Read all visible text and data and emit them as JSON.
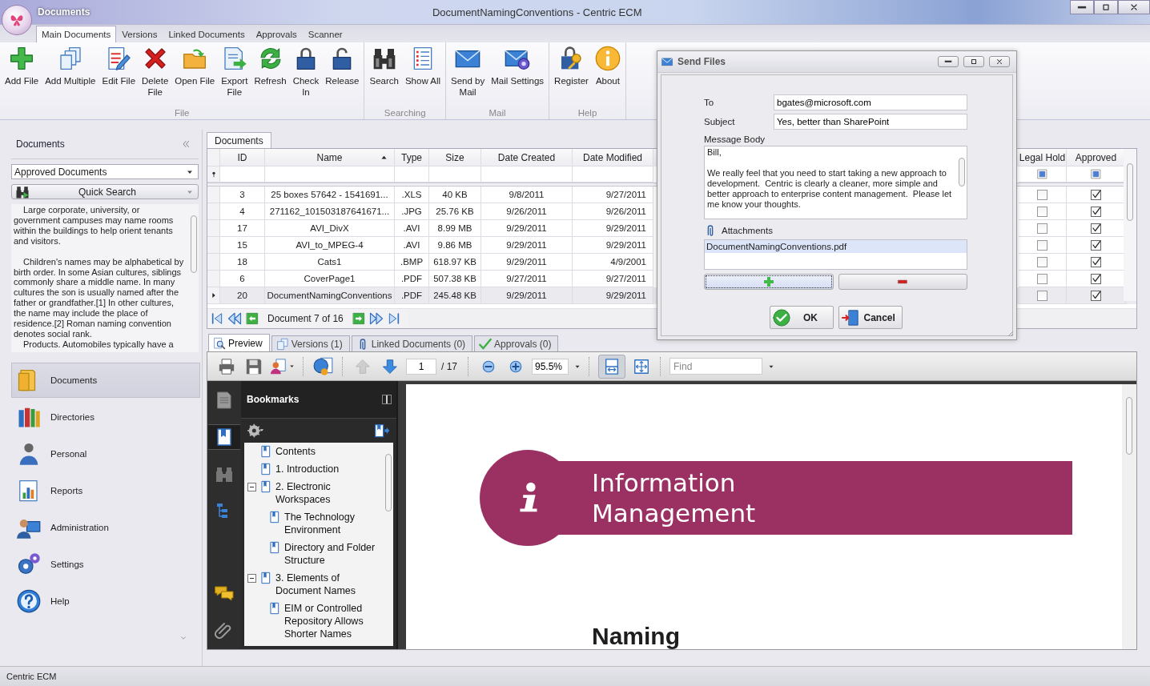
{
  "title_bar": {
    "menu_label": "Documents",
    "title": "DocumentNamingConventions - Centric ECM"
  },
  "ribbon_tabs": [
    {
      "label": "Main Documents",
      "selected": true
    },
    {
      "label": "Versions",
      "selected": false
    },
    {
      "label": "Linked Documents",
      "selected": false
    },
    {
      "label": "Approvals",
      "selected": false
    },
    {
      "label": "Scanner",
      "selected": false
    }
  ],
  "ribbon_groups": [
    {
      "label": "File",
      "buttons": [
        {
          "label": "Add File",
          "kind": "add"
        },
        {
          "label": "Add Multiple",
          "kind": "multiple"
        },
        {
          "label": "Edit File",
          "kind": "edit"
        },
        {
          "label": "Delete\nFile",
          "kind": "delete"
        },
        {
          "label": "Open File",
          "kind": "open"
        },
        {
          "label": "Export\nFile",
          "kind": "export"
        },
        {
          "label": "Refresh",
          "kind": "refresh"
        },
        {
          "label": "Check\nIn",
          "kind": "checkin"
        },
        {
          "label": "Release",
          "kind": "release"
        }
      ]
    },
    {
      "label": "Searching",
      "buttons": [
        {
          "label": "Search",
          "kind": "search"
        },
        {
          "label": "Show All",
          "kind": "list"
        }
      ]
    },
    {
      "label": "Mail",
      "buttons": [
        {
          "label": "Send by\nMail",
          "kind": "mail"
        },
        {
          "label": "Mail Settings",
          "kind": "mailsettings"
        }
      ]
    },
    {
      "label": "Help",
      "buttons": [
        {
          "label": "Register",
          "kind": "register"
        },
        {
          "label": "About",
          "kind": "about"
        }
      ]
    }
  ],
  "sidebar": {
    "title": "Documents",
    "filter": "Approved Documents",
    "quick_search": "Quick Search",
    "description": [
      "Large corporate, university, or government campuses may name rooms within the buildings to help orient tenants and visitors.",
      "Children's names may be alphabetical by birth order. In some Asian cultures, siblings commonly share a middle name. In many cultures the son is usually named after the father or grandfather.[1] In other cultures, the name may include the place of residence.[2] Roman naming convention denotes social rank.",
      "Products. Automobiles typically have a"
    ],
    "items": [
      {
        "label": "Documents",
        "kind": "documents",
        "selected": true
      },
      {
        "label": "Directories",
        "kind": "directories",
        "selected": false
      },
      {
        "label": "Personal",
        "kind": "personal",
        "selected": false
      },
      {
        "label": "Reports",
        "kind": "reports",
        "selected": false
      },
      {
        "label": "Administration",
        "kind": "administration",
        "selected": false
      },
      {
        "label": "Settings",
        "kind": "settings",
        "selected": false
      },
      {
        "label": "Help",
        "kind": "help",
        "selected": false
      }
    ]
  },
  "documents_tab": "Documents",
  "table": {
    "columns": [
      {
        "label": "ID",
        "sorted": false
      },
      {
        "label": "Name",
        "sorted": true
      },
      {
        "label": "Type",
        "sorted": false
      },
      {
        "label": "Size",
        "sorted": false
      },
      {
        "label": "Date Created",
        "sorted": false
      },
      {
        "label": "Date Modified",
        "sorted": false
      },
      {
        "label": "Legal Hold",
        "sorted": false
      },
      {
        "label": "Approved",
        "sorted": false
      }
    ],
    "rows": [
      {
        "id": "3",
        "name": "25 boxes 57642 - 1541691...",
        "type": ".XLS",
        "size": "40 KB",
        "created": "9/8/2011",
        "modified": "9/27/2011",
        "legal_hold": false,
        "approved": true,
        "selected": false
      },
      {
        "id": "4",
        "name": "271162_101503187641671...",
        "type": ".JPG",
        "size": "25.76 KB",
        "created": "9/26/2011",
        "modified": "9/26/2011",
        "legal_hold": false,
        "approved": true,
        "selected": false
      },
      {
        "id": "17",
        "name": "AVI_DivX",
        "type": ".AVI",
        "size": "8.99 MB",
        "created": "9/29/2011",
        "modified": "9/29/2011",
        "legal_hold": false,
        "approved": true,
        "selected": false
      },
      {
        "id": "15",
        "name": "AVI_to_MPEG-4",
        "type": ".AVI",
        "size": "9.86 MB",
        "created": "9/29/2011",
        "modified": "9/29/2011",
        "legal_hold": false,
        "approved": true,
        "selected": false
      },
      {
        "id": "18",
        "name": "Cats1",
        "type": ".BMP",
        "size": "618.97 KB",
        "created": "9/29/2011",
        "modified": "4/9/2001",
        "legal_hold": false,
        "approved": true,
        "selected": false
      },
      {
        "id": "6",
        "name": "CoverPage1",
        "type": ".PDF",
        "size": "507.38 KB",
        "created": "9/27/2011",
        "modified": "9/27/2011",
        "legal_hold": false,
        "approved": true,
        "selected": false
      },
      {
        "id": "20",
        "name": "DocumentNamingConventions",
        "type": ".PDF",
        "size": "245.48 KB",
        "created": "9/29/2011",
        "modified": "9/29/2011",
        "legal_hold": false,
        "approved": true,
        "selected": true
      }
    ]
  },
  "navigator": "Document 7 of 16",
  "preview_tabs": [
    {
      "label": "Preview",
      "kind": "preview",
      "selected": true
    },
    {
      "label": "Versions (1)",
      "kind": "versions",
      "selected": false
    },
    {
      "label": "Linked Documents (0)",
      "kind": "linked",
      "selected": false
    },
    {
      "label": "Approvals (0)",
      "kind": "approvals",
      "selected": false
    }
  ],
  "viewer": {
    "page": "1",
    "page_count": "/ 17",
    "zoom": "95.5%",
    "find_placeholder": "Find",
    "bookmarks": {
      "title": "Bookmarks",
      "items": [
        {
          "label": "Contents"
        },
        {
          "label": "1. Introduction"
        },
        {
          "label": "2. Electronic Workspaces",
          "expanded": true,
          "children": [
            {
              "label": "The Technology Environment"
            },
            {
              "label": "Directory and Folder Structure"
            }
          ]
        },
        {
          "label": "3. Elements of Document Names",
          "expanded": true,
          "children": [
            {
              "label": "EIM or Controlled Repository Allows Shorter Names"
            }
          ]
        }
      ]
    },
    "document": {
      "banner": "Information Management",
      "heading": "Naming"
    }
  },
  "dialog": {
    "title": "Send Files",
    "fields": [
      {
        "label": "To",
        "value": "bgates@microsoft.com"
      },
      {
        "label": "Subject",
        "value": "Yes, better than SharePoint"
      }
    ],
    "body_label": "Message Body",
    "body": "Bill,\n\nWe really feel that you need to start taking a new approach to development.  Centric is clearly a cleaner, more simple and better approach to enterprise content management.  Please let me know your thoughts.",
    "attachments_label": "Attachments",
    "attachments": [
      {
        "name": "DocumentNamingConventions.pdf",
        "selected": true
      }
    ],
    "buttons": [
      {
        "label": "OK",
        "kind": "ok"
      },
      {
        "label": "Cancel",
        "kind": "cancel"
      }
    ]
  },
  "status_bar": "Centric ECM"
}
